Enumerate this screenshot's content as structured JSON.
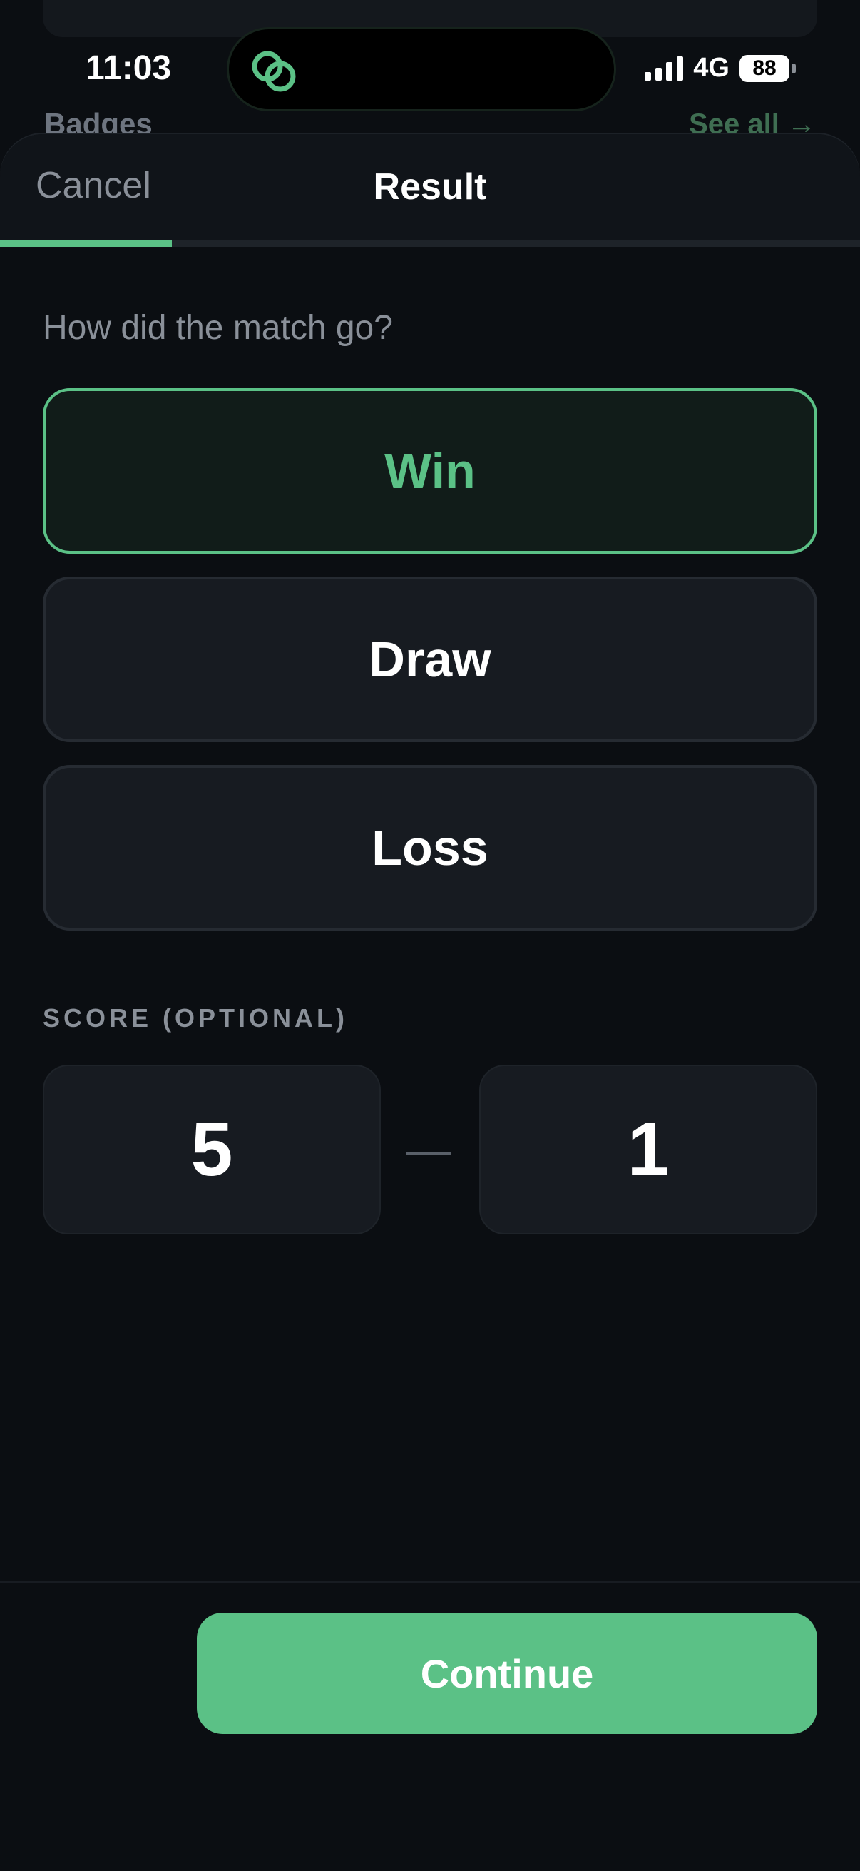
{
  "background_screen": {
    "section_title": "Badges",
    "see_all": "See all →"
  },
  "status_bar": {
    "time": "11:03",
    "network": "4G",
    "battery": "88"
  },
  "sheet": {
    "cancel_label": "Cancel",
    "title": "Result",
    "progress_fraction": 0.2,
    "question": "How did the match go?",
    "options": [
      {
        "label": "Win",
        "selected": true
      },
      {
        "label": "Draw",
        "selected": false
      },
      {
        "label": "Loss",
        "selected": false
      }
    ],
    "score_label": "SCORE (OPTIONAL)",
    "score_home": "5",
    "score_away": "1",
    "continue_label": "Continue"
  },
  "colors": {
    "accent": "#5bc186",
    "background": "#0b0e12",
    "card": "#171b21"
  }
}
